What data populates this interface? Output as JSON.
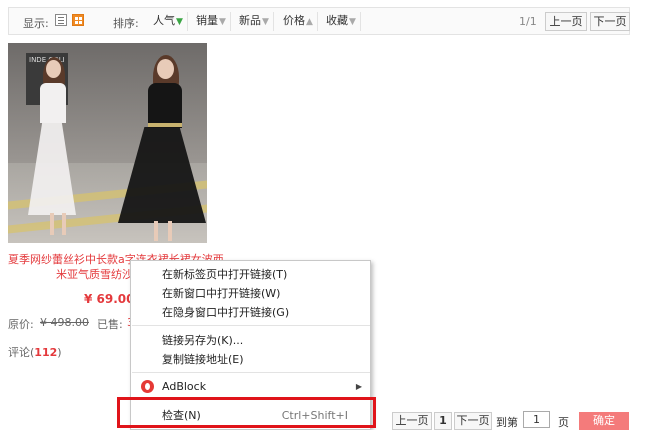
{
  "toolbar": {
    "display_label": "显示:",
    "sort_label": "排序:",
    "sort_options": [
      "人气",
      "销量",
      "新品",
      "价格",
      "收藏"
    ],
    "page_count": "1/1",
    "prev_label": "上一页",
    "next_label": "下一页"
  },
  "product": {
    "title_line1": "夏季网纱蕾丝衫中长款a字连衣裙长裙女波西",
    "title_line2": "米亚气质雪纺沙滩",
    "sign_text": "INDE COLI",
    "price": "¥ 69.00",
    "original_label": "原价:",
    "original_price": "¥ 498.00",
    "sold_label": "已售:",
    "sold_value": "3",
    "review_label": "评论(",
    "review_count": "112",
    "review_close": ")"
  },
  "context_menu": {
    "items": [
      "在新标签页中打开链接(T)",
      "在新窗口中打开链接(W)",
      "在隐身窗口中打开链接(G)",
      "链接另存为(K)...",
      "复制链接地址(E)",
      "AdBlock",
      "检查(N)"
    ],
    "inspect_shortcut": "Ctrl+Shift+I"
  },
  "bottom_pager": {
    "prev_label": "上一页",
    "current_page": "1",
    "next_label": "下一页",
    "goto_label": "到第",
    "page_input": "1",
    "page_suffix": "页",
    "confirm_label": "确定"
  },
  "colors": {
    "accent": "#e4393c",
    "highlight": "#e0141a",
    "confirm_button": "#f47b7b"
  }
}
